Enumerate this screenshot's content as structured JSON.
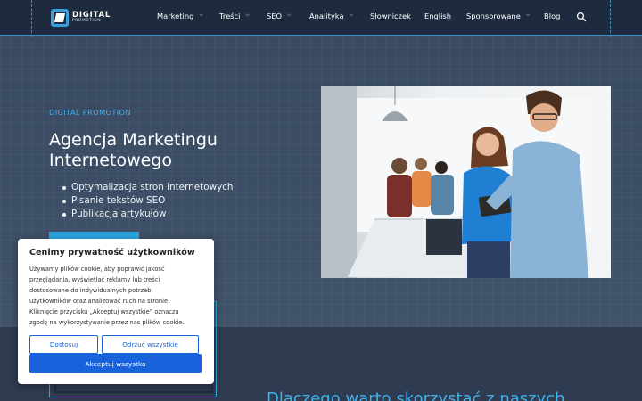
{
  "brand": {
    "name": "DIGITAL",
    "tagline": "PROMOTION"
  },
  "nav": {
    "items": [
      {
        "label": "Marketing",
        "dropdown": true
      },
      {
        "label": "Treści",
        "dropdown": true
      },
      {
        "label": "SEO",
        "dropdown": true
      },
      {
        "label": "Analityka",
        "dropdown": true
      },
      {
        "label": "Słowniczek",
        "dropdown": false
      },
      {
        "label": "English",
        "dropdown": false
      },
      {
        "label": "Sponsorowane",
        "dropdown": true
      },
      {
        "label": "Blog",
        "dropdown": false
      }
    ],
    "search_icon": "search-icon",
    "chevron_icon": "chevron-down-icon"
  },
  "hero": {
    "kicker": "DIGITAL PROMOTION",
    "title": "Agencja Marketingu Internetowego",
    "bullets": [
      "Optymalizacja stron internetowych",
      "Pisanie tekstów SEO",
      "Publikacja artykułów"
    ]
  },
  "section": {
    "title": "Dlaczego warto skorzystać z naszych"
  },
  "cookie": {
    "title": "Cenimy prywatność użytkowników",
    "lines": [
      "Używamy plików cookie, aby poprawić jakość",
      "przeglądania, wyświetlać reklamy lub treści",
      "dostosowane do indywidualnych potrzeb",
      "użytkowników oraz analizować ruch na stronie.",
      "Kliknięcie przycisku „Akceptuj wszystkie” oznacza",
      "zgodę na wykorzystywanie przez nas plików cookie."
    ],
    "customize_label": "Dostosuj",
    "reject_label": "Odrzuć wszystkie",
    "accept_label": "Akceptuj wszystko"
  },
  "colors": {
    "header_bg": "#1e2b3f",
    "accent": "#2aa7e3",
    "cookie_primary": "#1863dc"
  }
}
